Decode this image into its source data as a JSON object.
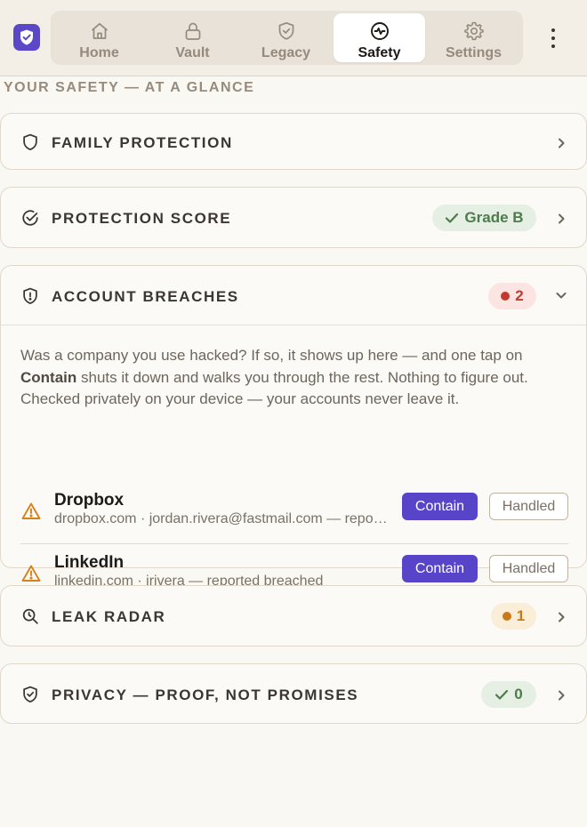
{
  "colors": {
    "accent": "#5744c9",
    "background": "#faf8f3",
    "grade_green": "#4d7c4b",
    "breach_red": "#c23a2f",
    "leak_amber": "#c97a18"
  },
  "nav": {
    "tabs": [
      {
        "label": "Home",
        "icon": "home-icon"
      },
      {
        "label": "Vault",
        "icon": "lock-icon"
      },
      {
        "label": "Legacy",
        "icon": "shield-check-icon"
      },
      {
        "label": "Safety",
        "icon": "pulse-icon",
        "active": true
      },
      {
        "label": "Settings",
        "icon": "gear-icon"
      }
    ],
    "menu_icon": "more-vertical-icon",
    "logo_icon": "shield-logo-icon"
  },
  "page": {
    "heading": "YOUR SAFETY — AT A GLANCE"
  },
  "cards": {
    "family": {
      "title": "FAMILY PROTECTION",
      "icon": "shield-icon"
    },
    "score": {
      "title": "PROTECTION SCORE",
      "icon": "check-circle-icon",
      "badge": "Grade B"
    },
    "breaches": {
      "title": "ACCOUNT BREACHES",
      "icon": "shield-alert-icon",
      "count": "2",
      "expanded": true,
      "desc_before": "Was a company you use hacked? If so, it shows up here — and one tap on ",
      "desc_bold": "Contain",
      "desc_after": " shuts it down and walks you through the rest. Nothing to figure out. Checked privately on your device — your accounts never leave it.",
      "items": [
        {
          "name": "Dropbox",
          "detail": "dropbox.com · jordan.rivera@fastmail.com — reported breached",
          "contain": "Contain",
          "handled": "Handled"
        },
        {
          "name": "LinkedIn",
          "detail": "linkedin.com · jrivera — reported breached",
          "contain": "Contain",
          "handled": "Handled"
        }
      ]
    },
    "leak": {
      "title": "LEAK RADAR",
      "icon": "search-icon",
      "count": "1"
    },
    "privacy": {
      "title": "PRIVACY — PROOF, NOT PROMISES",
      "icon": "shield-check-icon",
      "count": "0"
    }
  }
}
